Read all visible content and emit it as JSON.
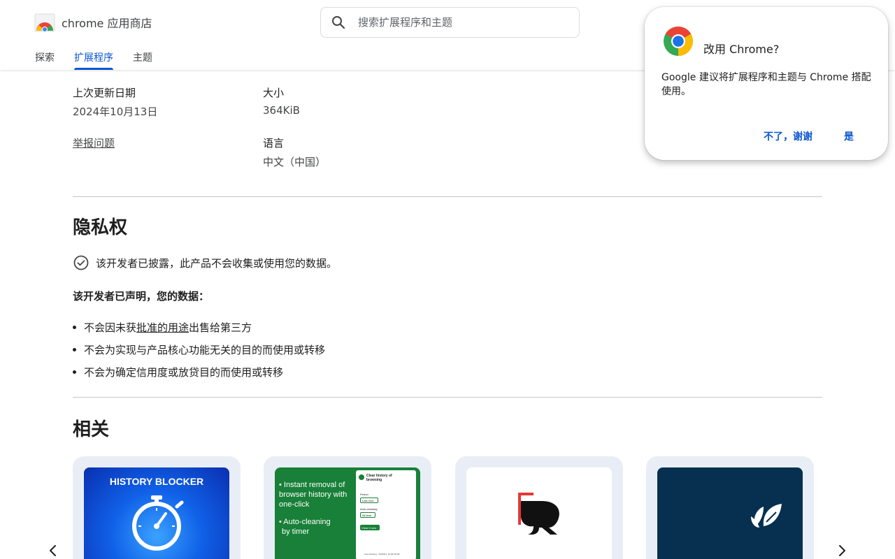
{
  "header": {
    "brand_name": "chrome 应用商店",
    "search": {
      "placeholder": "搜索扩展程序和主题"
    },
    "tabs": [
      {
        "label": "探索",
        "active": false
      },
      {
        "label": "扩展程序",
        "active": true
      },
      {
        "label": "主题",
        "active": false
      }
    ]
  },
  "details": {
    "updated_label": "上次更新日期",
    "updated_value": "2024年10月13日",
    "size_label": "大小",
    "size_value": "364KiB",
    "report_link": "举报问题",
    "language_label": "语言",
    "language_value": "中文（中国）"
  },
  "privacy": {
    "title": "隐私权",
    "disclosure": "该开发者已披露，此产品不会收集或使用您的数据。",
    "declared_heading": "该开发者已声明，您的数据：",
    "bullets": {
      "b1_prefix": "不会因未获",
      "b1_link": "批准的用途",
      "b1_suffix": "出售给第三方",
      "b2": "不会为实现与产品核心功能无关的目的而使用或转移",
      "b3": "不会为确定信用度或放贷目的而使用或转移"
    }
  },
  "related": {
    "title": "相关",
    "cards": [
      {
        "icon": "history-blocker-image",
        "text": "HISTORY BLOCKER"
      },
      {
        "icon": "clear-history-image",
        "lines": [
          "• Instant removal of",
          "browser history with",
          "one-click",
          "• Auto-cleaning",
          "by timer"
        ],
        "mini_title": "Clear history of browsing",
        "mini_period": "Period",
        "mini_period_value": "Last hour",
        "mini_auto": "Auto-cleaning",
        "mini_auto_value": "All time",
        "mini_button": "Clear it now",
        "mini_footer": "Last cleaning - 2/4/2021, 10:40:46 AM"
      },
      {
        "icon": "black-spade-logo"
      },
      {
        "icon": "white-leaf-logo"
      }
    ]
  },
  "popup": {
    "title": "改用 Chrome?",
    "body": "Google 建议将扩展程序和主题与 Chrome 搭配使用。",
    "decline": "不了，谢谢",
    "accept": "是"
  },
  "colors": {
    "accent": "#0b57d0",
    "card_bg": "#e9eef6",
    "green_card": "#188038",
    "navy_card": "#073050"
  }
}
